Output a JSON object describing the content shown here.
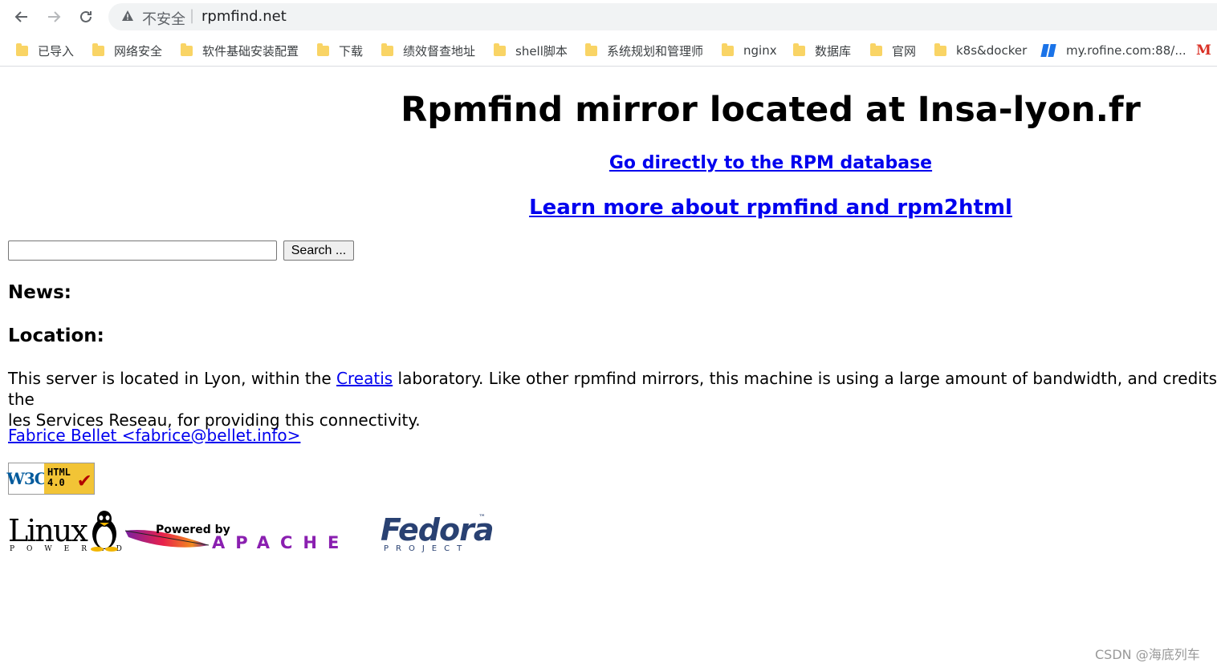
{
  "browser": {
    "insecure_label": "不安全",
    "separator": "|",
    "url": "rpmfind.net",
    "icons": [
      "back-arrow-icon",
      "forward-arrow-icon",
      "reload-icon",
      "warning-icon"
    ],
    "bookmarks": [
      {
        "label": "已导入",
        "icon": "folder-icon"
      },
      {
        "label": "网络安全",
        "icon": "folder-icon"
      },
      {
        "label": "软件基础安装配置",
        "icon": "folder-icon"
      },
      {
        "label": "下载",
        "icon": "folder-icon"
      },
      {
        "label": "绩效督查地址",
        "icon": "folder-icon"
      },
      {
        "label": "shell脚本",
        "icon": "folder-icon"
      },
      {
        "label": "系统规划和管理师",
        "icon": "folder-icon"
      },
      {
        "label": "nginx",
        "icon": "folder-icon"
      },
      {
        "label": "数据库",
        "icon": "folder-icon"
      },
      {
        "label": "官网",
        "icon": "folder-icon"
      },
      {
        "label": "k8s&docker",
        "icon": "folder-icon"
      },
      {
        "label": "my.rofine.com:88/...",
        "icon": "rofine-icon"
      },
      {
        "label": "M",
        "icon": "gmail-icon"
      }
    ]
  },
  "page": {
    "title": "Rpmfind mirror located at Insa-lyon.fr",
    "link_database": "Go directly to the RPM database",
    "link_learn": "Learn more about rpmfind and rpm2html",
    "search": {
      "value": "",
      "button": "Search ..."
    },
    "news_heading": "News:",
    "location_heading": "Location:",
    "location_text_before": "This server is located in Lyon, within the ",
    "location_link": "Creatis",
    "location_text_after": " laboratory. Like other rpmfind mirrors, this machine is using a large amount of bandwidth, and credits go to the ",
    "location_text_line2": "les Services Reseau, for providing this connectivity.",
    "author_link": "Fabrice Bellet <fabrice@bellet.info>",
    "badges": {
      "w3c_left": "W3C",
      "w3c_right_1": "HTML",
      "w3c_right_2": "4.0",
      "linux_title": "Linux",
      "linux_sub": "POWERED",
      "apache_top": "Powered by",
      "apache_word": "APACHE",
      "fedora_title": "Fedora",
      "fedora_tm": "™",
      "fedora_sub": "PROJECT"
    }
  },
  "watermark": "CSDN @海底列车"
}
